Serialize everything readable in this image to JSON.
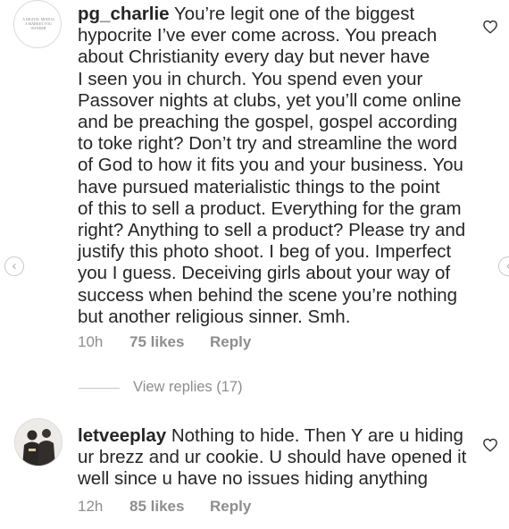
{
  "comments": [
    {
      "username": "pg_charlie",
      "avatar_text": "A DIGITAL MIND IS A MARKET YOU WANDER",
      "lines": [
        " You’re legit one of the biggest",
        "hypocrite I’ve ever come across. You preach",
        "about Christianity every day but never have",
        "I seen you in church. You spend even your",
        "Passover nights at clubs, yet you’ll come online",
        "and be preaching the gospel, gospel according",
        "to toke right? Don’t try and streamline the word",
        "of God to how it fits you and your business. You",
        "have pursued materialistic things to the point",
        "of this to sell a product. Everything for the gram",
        "right? Anything to sell a product? Please try and",
        "justify this photo shoot. I beg of you. Imperfect",
        "you I guess. Deceiving girls about your way of",
        "success when behind the scene you’re nothing",
        "but another religious sinner. Smh."
      ],
      "time": "10h",
      "likes": "75 likes",
      "reply": "Reply",
      "view_replies": "View replies (17)"
    },
    {
      "username": "letveeplay",
      "lines": [
        " Nothing to hide. Then Y are u hiding",
        "ur brezz and ur cookie. U should have opened it",
        "well since u have no issues hiding anything"
      ],
      "time": "12h",
      "likes": "85 likes",
      "reply": "Reply"
    }
  ],
  "icons": {
    "like": "heart-outline-icon",
    "prev": "chevron-left-icon",
    "next": "chevron-right-icon"
  },
  "nav": {
    "prev_glyph": "‹",
    "next_glyph": "‹"
  }
}
